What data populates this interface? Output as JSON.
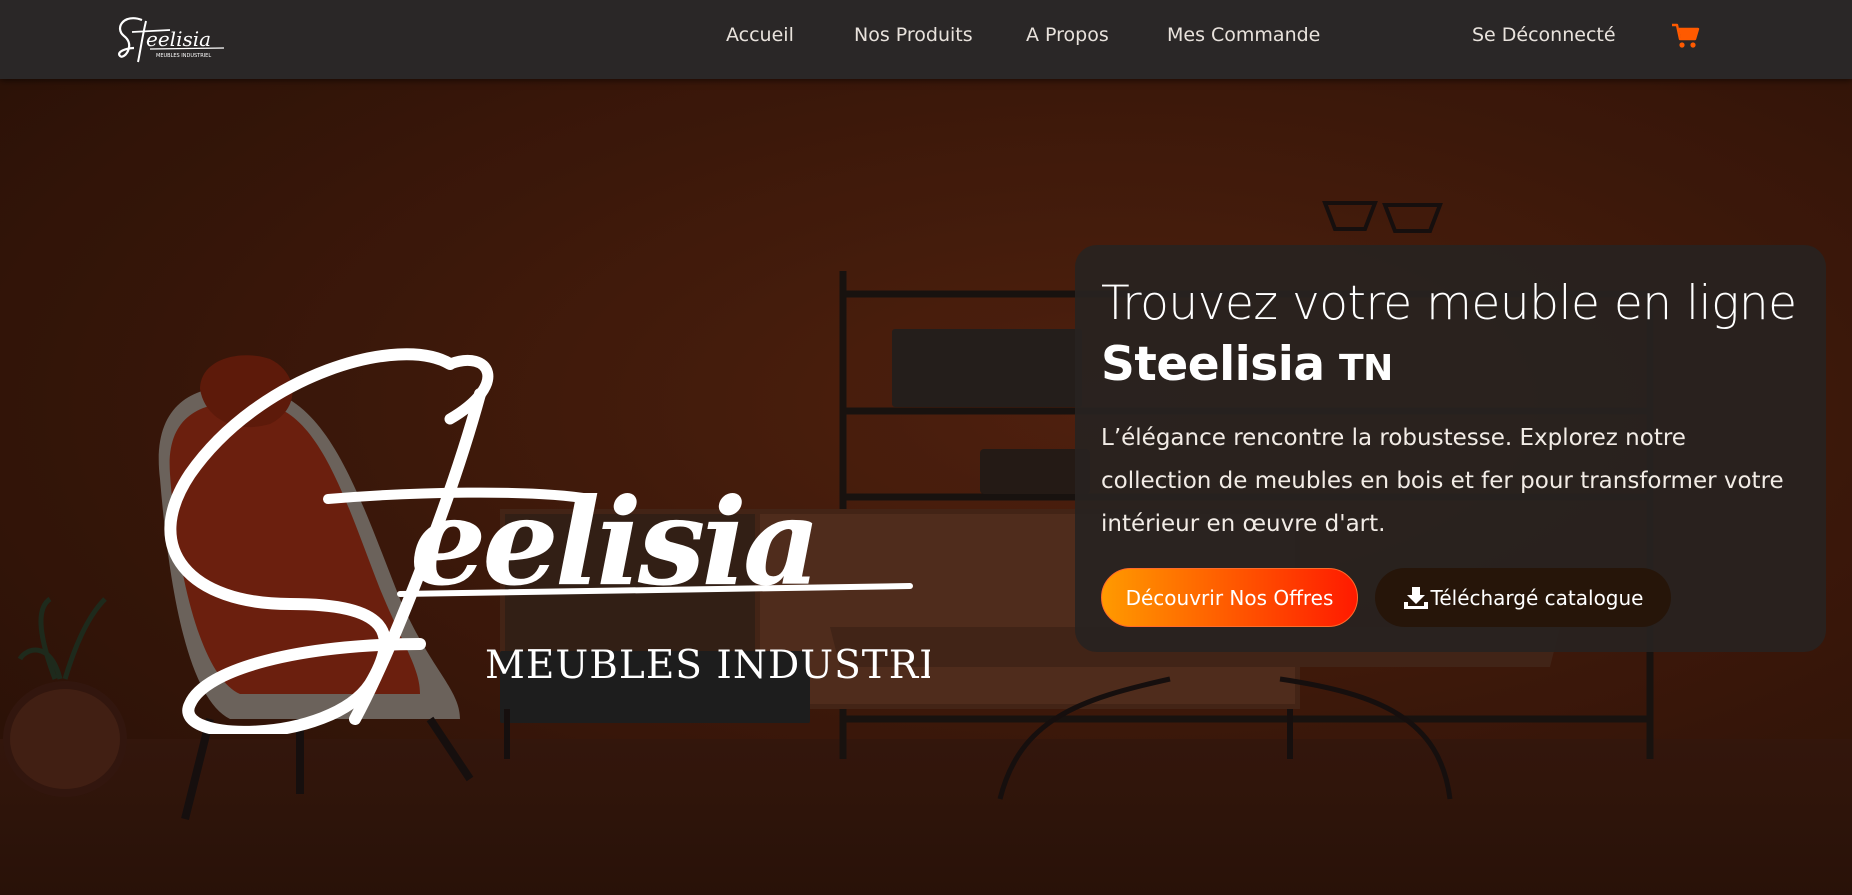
{
  "navbar": {
    "logo_script": "Steelisia",
    "logo_tagline": "MEUBLES INDUSTRIEL",
    "links": [
      {
        "label": "Accueil"
      },
      {
        "label": "Nos Produits"
      },
      {
        "label": "A Propos"
      },
      {
        "label": "Mes Commande"
      }
    ],
    "logout_label": "Se Déconnecté",
    "cart_icon": "cart-icon"
  },
  "hero": {
    "logo_script": "Steelisia",
    "logo_tagline": "MEUBLES INDUSTRIEL",
    "headline_part1": "Trouvez votre meuble en ligne ",
    "headline_brand": "Steelisia",
    "headline_suffix": "TN",
    "description": "L’élégance rencontre la robustesse. Explorez notre collection de meubles en bois et fer pour transformer votre intérieur en œuvre d'art.",
    "primary_button": "Découvrir Nos Offres",
    "secondary_button": "Téléchargé catalogue",
    "download_icon": "download-icon"
  },
  "colors": {
    "navbar_bg": "#2a2727",
    "accent_orange": "#ff9a00",
    "accent_red": "#ff1a00",
    "cart": "#ff5a00",
    "hero_bg": "#451c0c"
  }
}
